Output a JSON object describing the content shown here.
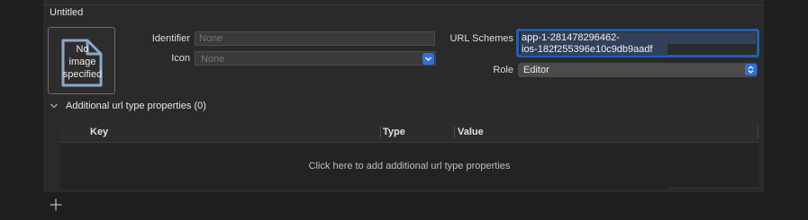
{
  "section": {
    "title": "Untitled"
  },
  "image_well": {
    "text": "No\nimage\nspecified"
  },
  "identifier": {
    "label": "Identifier",
    "placeholder": "None"
  },
  "icon_field": {
    "label": "Icon",
    "value": "None"
  },
  "url_schemes": {
    "label": "URL Schemes",
    "line1": "app-1-281478296462-",
    "line2": "ios-182f255396e10c9db9aadf"
  },
  "role": {
    "label": "Role",
    "value": "Editor"
  },
  "additional": {
    "title": "Additional url type properties (0)",
    "columns": [
      "Key",
      "Type",
      "Value"
    ],
    "empty_text": "Click here to add additional url type properties"
  },
  "colors": {
    "accent": "#2f6fe0",
    "focus_ring": "#1f5fb3",
    "panel": "#2a2a2a",
    "background": "#1e1e1e"
  },
  "icons": {
    "add": "plus-icon",
    "disclosure": "chevron-down-icon",
    "popup": "chevron-up-down-icon"
  }
}
